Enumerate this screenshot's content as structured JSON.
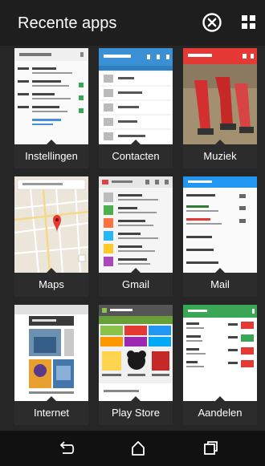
{
  "header": {
    "title": "Recente apps",
    "close_icon": "circle-x-icon",
    "layout_icon": "grid-layout-icon"
  },
  "apps": [
    {
      "label": "Instellingen",
      "icon": "settings-thumbnail"
    },
    {
      "label": "Contacten",
      "icon": "contacts-thumbnail"
    },
    {
      "label": "Muziek",
      "icon": "music-thumbnail"
    },
    {
      "label": "Maps",
      "icon": "maps-thumbnail"
    },
    {
      "label": "Gmail",
      "icon": "gmail-thumbnail"
    },
    {
      "label": "Mail",
      "icon": "mail-thumbnail"
    },
    {
      "label": "Internet",
      "icon": "internet-thumbnail"
    },
    {
      "label": "Play Store",
      "icon": "play-store-thumbnail"
    },
    {
      "label": "Aandelen",
      "icon": "stocks-thumbnail"
    }
  ],
  "navbar": {
    "back_icon": "back-icon",
    "home_icon": "home-icon",
    "recents_icon": "recent-apps-icon"
  },
  "colors": {
    "background": "#262626",
    "label_bg": "#2c2c2c",
    "contacts_blue": "#3b8fd4",
    "music_red": "#e53935",
    "stocks_green": "#3aa757",
    "mail_blue": "#2196f3"
  }
}
